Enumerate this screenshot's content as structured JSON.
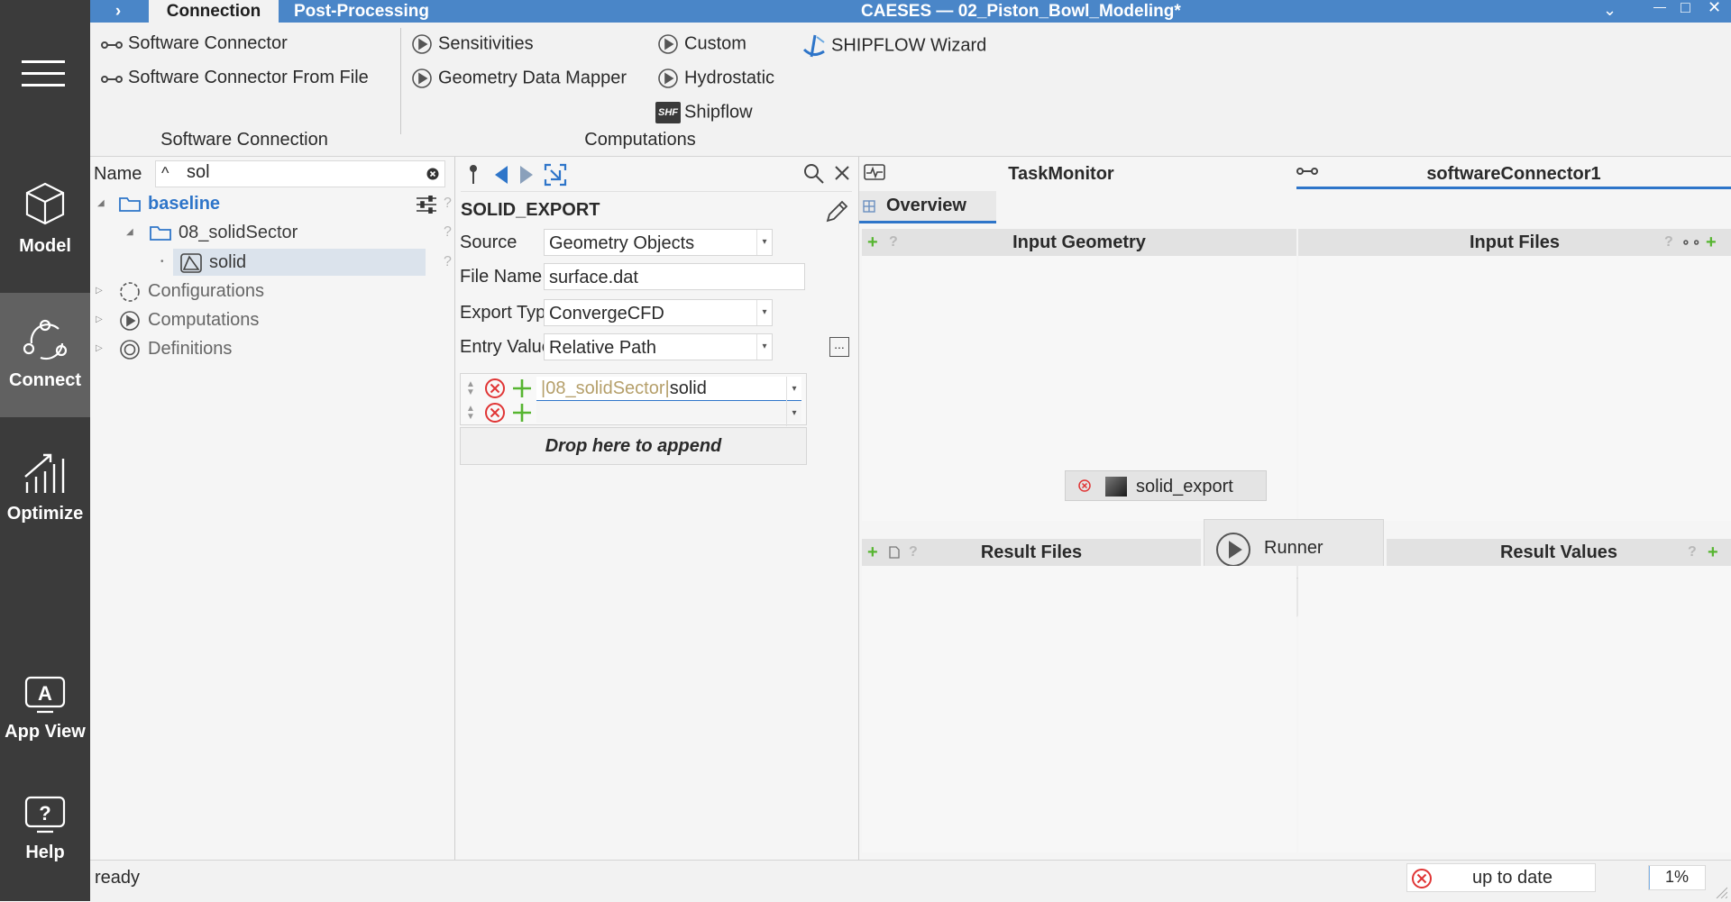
{
  "window": {
    "title": "CAESES — 02_Piston_Bowl_Modeling*",
    "tabs": [
      {
        "label": "›"
      },
      {
        "label": "Connection"
      },
      {
        "label": "Post-Processing"
      }
    ],
    "controls": {
      "dropdown": "⌄",
      "minimize": "—",
      "maximize": "□",
      "close": "✕"
    }
  },
  "nav": [
    {
      "label": "Model",
      "icon": "cube-icon"
    },
    {
      "label": "Connect",
      "icon": "connect-icon",
      "active": true
    },
    {
      "label": "Optimize",
      "icon": "optimize-icon"
    },
    {
      "label": "App View",
      "icon": "app-view-icon"
    },
    {
      "label": "Help",
      "icon": "help-icon"
    }
  ],
  "ribbon": {
    "groups": [
      {
        "label": "Software Connection",
        "items": [
          "Software Connector",
          "Software Connector From File"
        ]
      },
      {
        "label": "Computations",
        "items": [
          "Sensitivities",
          "Geometry Data Mapper",
          "Custom",
          "Hydrostatic",
          "Shipflow"
        ]
      }
    ],
    "shipflow_wizard": "SHIPFLOW Wizard",
    "shipflow_badge": "SHF"
  },
  "tree": {
    "header_label": "Name",
    "sort_glyph": "^",
    "filter_value": "sol",
    "items": [
      {
        "label": "baseline",
        "expanded": true,
        "type": "folder"
      },
      {
        "label": "08_solidSector",
        "expanded": true,
        "type": "folder"
      },
      {
        "label": "solid",
        "selected": true,
        "type": "solid"
      },
      {
        "label": "Configurations",
        "type": "configurations"
      },
      {
        "label": "Computations",
        "type": "computations"
      },
      {
        "label": "Definitions",
        "type": "definitions"
      }
    ],
    "help_mark": "?"
  },
  "editor": {
    "title": "SOLID_EXPORT",
    "fields": [
      {
        "label": "Source",
        "value": "Geometry Objects",
        "dropdown": true
      },
      {
        "label": "File Name",
        "value": "surface.dat",
        "dropdown": false
      },
      {
        "label": "Export Type",
        "value": "ConvergeCFD",
        "dropdown": true
      },
      {
        "label": "Entry Value",
        "value": "Relative Path",
        "dropdown": true
      }
    ],
    "entries": [
      {
        "path_prefix": "|08_solidSector|",
        "value": "solid"
      },
      {
        "path_prefix": "",
        "value": ""
      }
    ],
    "more_button": "...",
    "drop_label": "Drop here to append"
  },
  "right": {
    "tab_taskmonitor": "TaskMonitor",
    "tab_connector": "softwareConnector1",
    "subtab_overview": "Overview",
    "input_geometry": "Input Geometry",
    "input_files": "Input Files",
    "result_files": "Result Files",
    "result_values": "Result Values",
    "chip_label": "solid_export",
    "runner_label": "Runner",
    "help_mark": "?",
    "link_glyph": "⚬⚬",
    "plus_glyph": "+"
  },
  "status": {
    "text": "ready",
    "state": "up to date",
    "progress_percent": 1,
    "progress_label": "1%"
  },
  "colors": {
    "titlebar": "#4a86c8",
    "nav": "#3b3b3b",
    "nav_active": "#616161",
    "accent_blue": "#2e75c9",
    "error_red": "#e03535",
    "plus_green": "#57b531"
  }
}
